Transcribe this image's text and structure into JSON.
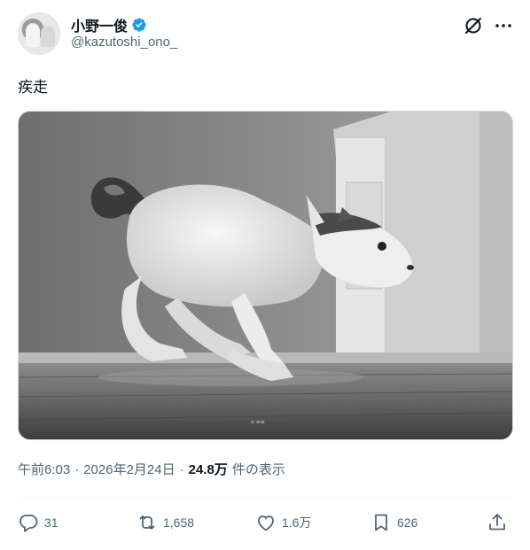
{
  "author": {
    "display_name": "小野一俊",
    "handle": "@kazutoshi_ono_"
  },
  "tweet": {
    "text": "疾走"
  },
  "meta": {
    "time": "午前6:03",
    "sep1": "·",
    "date": "2026年2月24日",
    "sep2": "·",
    "views_count": "24.8万",
    "views_label": "件の表示"
  },
  "actions": {
    "replies": "31",
    "reposts": "1,658",
    "likes": "1.6万",
    "bookmarks": "626"
  },
  "icons": {
    "verified": "verified-badge-icon",
    "grok": "grok-icon",
    "more": "more-icon",
    "reply": "reply-icon",
    "repost": "repost-icon",
    "like": "heart-icon",
    "bookmark": "bookmark-icon",
    "share": "share-icon"
  },
  "colors": {
    "verified_blue": "#1d9bf0",
    "secondary_text": "#536471",
    "primary_text": "#0f1419"
  }
}
